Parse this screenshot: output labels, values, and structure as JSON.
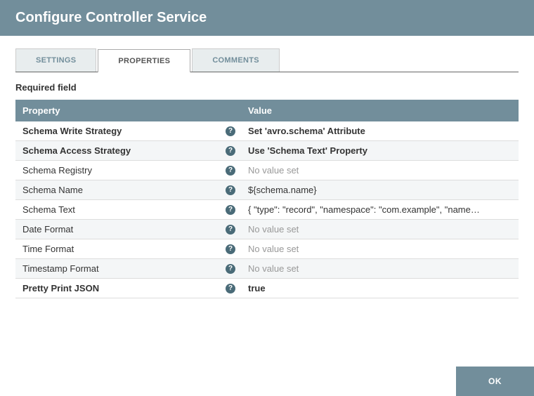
{
  "header": {
    "title": "Configure Controller Service"
  },
  "tabs": {
    "settings": "SETTINGS",
    "properties": "PROPERTIES",
    "comments": "COMMENTS"
  },
  "required_label": "Required field",
  "table": {
    "headers": {
      "property": "Property",
      "value": "Value"
    },
    "rows": [
      {
        "name": "Schema Write Strategy",
        "required": true,
        "value": "Set 'avro.schema' Attribute",
        "placeholder": false
      },
      {
        "name": "Schema Access Strategy",
        "required": true,
        "value": "Use 'Schema Text' Property",
        "placeholder": false
      },
      {
        "name": "Schema Registry",
        "required": false,
        "value": "No value set",
        "placeholder": true
      },
      {
        "name": "Schema Name",
        "required": false,
        "value": "${schema.name}",
        "placeholder": false
      },
      {
        "name": "Schema Text",
        "required": false,
        "value": "{ \"type\": \"record\", \"namespace\": \"com.example\", \"name\": \"...",
        "placeholder": false
      },
      {
        "name": "Date Format",
        "required": false,
        "value": "No value set",
        "placeholder": true
      },
      {
        "name": "Time Format",
        "required": false,
        "value": "No value set",
        "placeholder": true
      },
      {
        "name": "Timestamp Format",
        "required": false,
        "value": "No value set",
        "placeholder": true
      },
      {
        "name": "Pretty Print JSON",
        "required": true,
        "value": "true",
        "placeholder": false
      }
    ]
  },
  "footer": {
    "ok": "OK"
  }
}
